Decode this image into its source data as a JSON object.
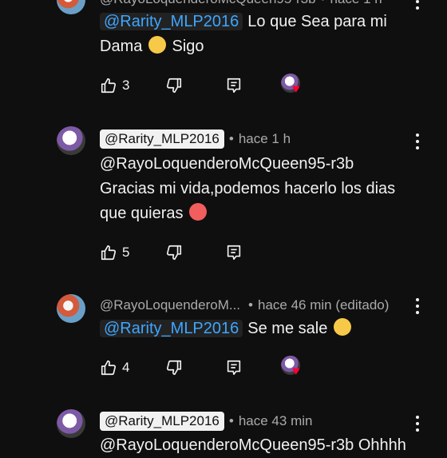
{
  "comments": [
    {
      "author": "@RayoLoquenderoMcQueen95-r3b",
      "time": "hace 1 h",
      "mention": "@Rarity_MLP2016",
      "text1": "Lo que Sea para mi",
      "text2": "Dama",
      "emoji_after": "😊",
      "text3": "Sigo",
      "likes": "3",
      "creator_heart": true
    },
    {
      "author": "@Rarity_MLP2016",
      "time": "hace 1 h",
      "line1": "@RayoLoquenderoMcQueen95-r3b",
      "line2": "Gracias mi vida,podemos hacerlo los dias",
      "line3": "que quieras",
      "emoji": "🥵",
      "likes": "5"
    },
    {
      "author": "@RayoLoquenderoM...",
      "time": "hace 46 min (editado)",
      "mention": "@Rarity_MLP2016",
      "text": "Se me sale",
      "emoji": "😣",
      "likes": "4",
      "creator_heart": true
    },
    {
      "author": "@Rarity_MLP2016",
      "time": "hace 43 min",
      "line1": "@RayoLoquenderoMcQueen95-r3b Ohhhh"
    }
  ],
  "icons": {
    "like": "thumbs-up-icon",
    "dislike": "thumbs-down-icon",
    "reply": "reply-icon",
    "menu": "more-vert-icon",
    "heart": "creator-heart-icon"
  },
  "colors": {
    "background": "#0f0f0f",
    "text": "#f1f1f1",
    "muted": "#aaaaaa",
    "mention": "#3ea6ff",
    "heart": "#ff0033"
  }
}
